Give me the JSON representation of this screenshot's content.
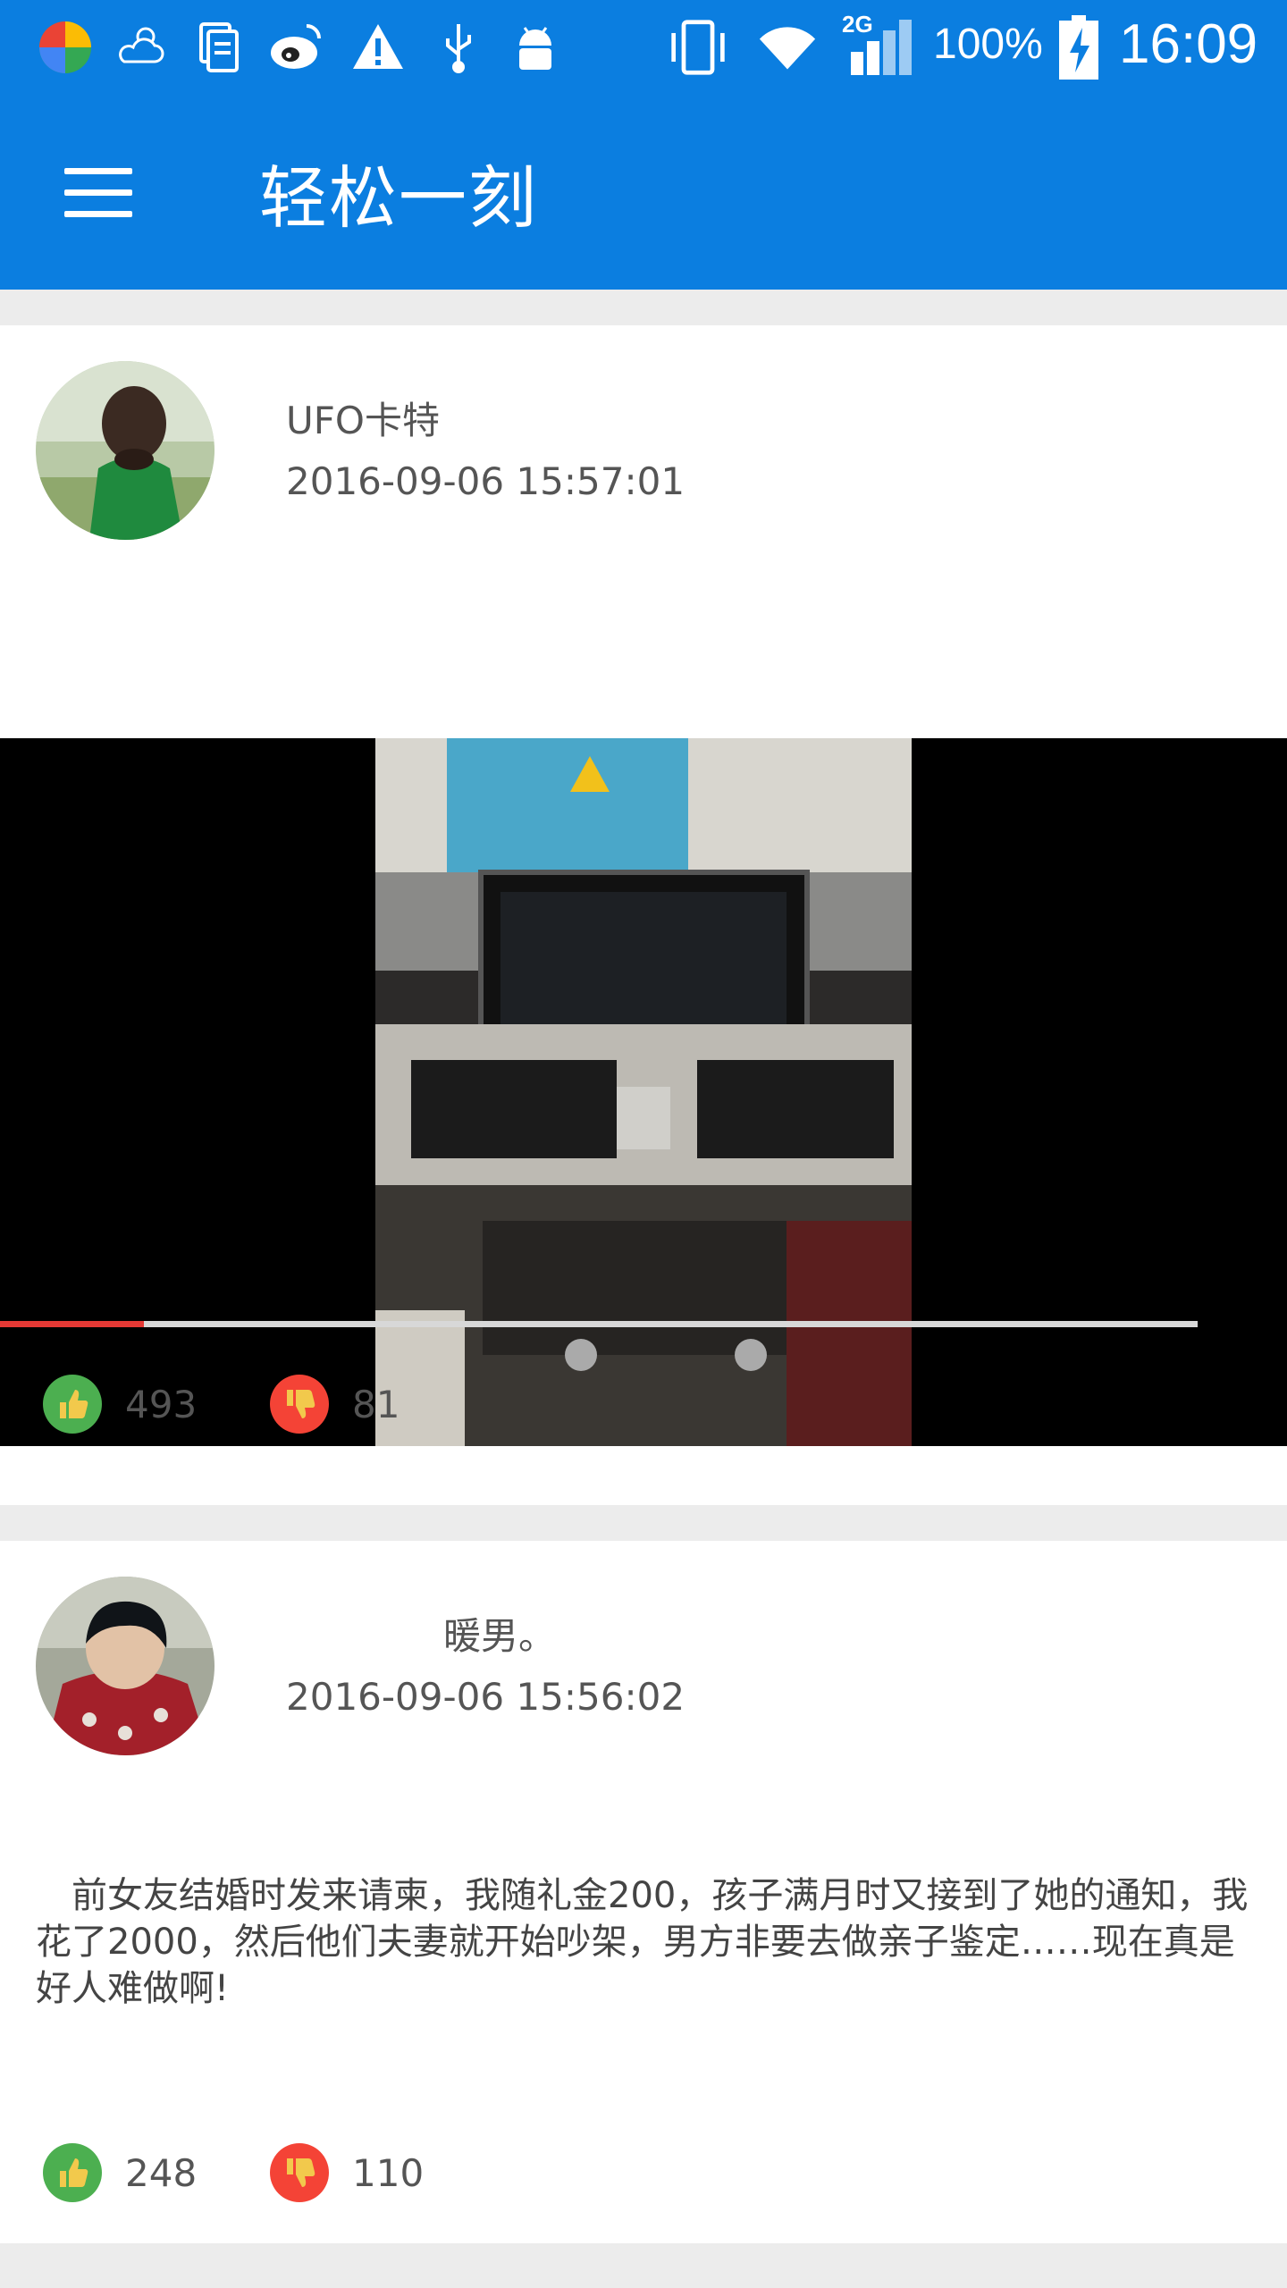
{
  "status_bar": {
    "battery": "100%",
    "time": "16:09",
    "network": "2G",
    "icons": [
      "app-logo-icon",
      "weather-icon",
      "document-icon",
      "weibo-icon",
      "warning-icon",
      "usb-icon",
      "android-debug-icon",
      "vibrate-icon",
      "wifi-icon",
      "signal-icon",
      "battery-charging-icon"
    ]
  },
  "app_bar": {
    "title": "轻松一刻",
    "menu_icon": "hamburger-menu-icon"
  },
  "colors": {
    "primary": "#0b7ee0",
    "like": "#4caf50",
    "dislike": "#f44336",
    "progress": "#e53935"
  },
  "posts": [
    {
      "username": "UFO卡特",
      "timestamp": "2016-09-06 15:57:01",
      "type": "video",
      "video_progress": 0.12,
      "likes": "493",
      "dislikes": "81"
    },
    {
      "username": "暖男。",
      "timestamp": "2016-09-06 15:56:02",
      "type": "text",
      "text": "前女友结婚时发来请柬，我随礼金200，孩子满月时又接到了她的通知，我花了2000，然后他们夫妻就开始吵架，男方非要去做亲子鉴定……现在真是好人难做啊!",
      "likes": "248",
      "dislikes": "110"
    }
  ]
}
